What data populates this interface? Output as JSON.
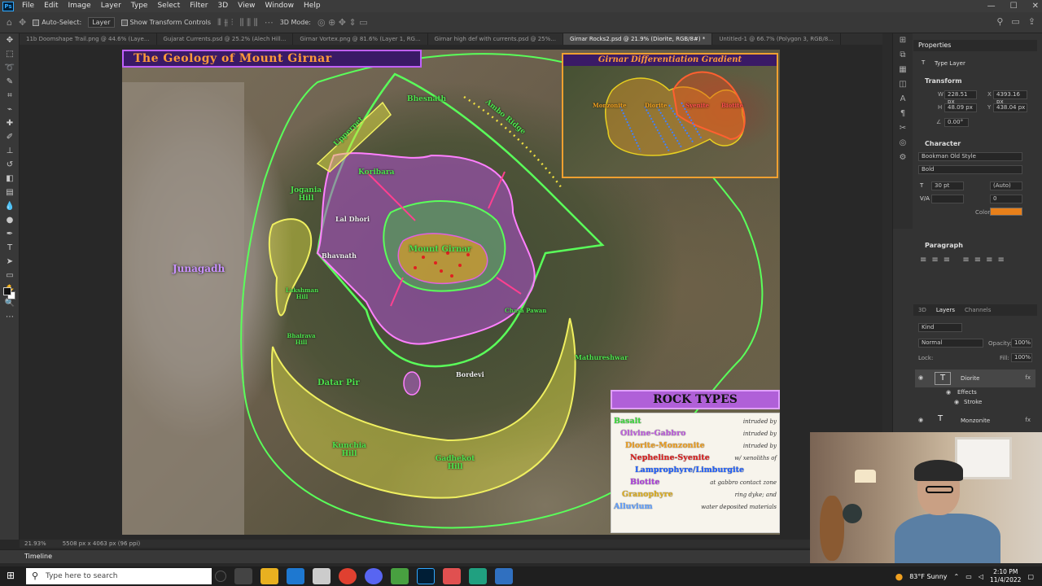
{
  "menubar": {
    "items": [
      "File",
      "Edit",
      "Image",
      "Layer",
      "Type",
      "Select",
      "Filter",
      "3D",
      "View",
      "Window",
      "Help"
    ]
  },
  "options_bar": {
    "auto_select_label": "Auto-Select:",
    "auto_select_value": "Layer",
    "transform_controls_label": "Show Transform Controls",
    "mode_label": "3D Mode:"
  },
  "tabs": [
    {
      "label": "11b Doomshape Trail.png @ 44.6% (Laye...",
      "active": false
    },
    {
      "label": "Gujarat Currents.psd @ 25.2% (Alech Hill...",
      "active": false
    },
    {
      "label": "Girnar Vortex.png @ 81.6% (Layer 1, RG...",
      "active": false
    },
    {
      "label": "Girnar high def with currents.psd @ 25%...",
      "active": false
    },
    {
      "label": "Girnar Rocks2.psd @ 21.9% (Diorite, RGB/8#) *",
      "active": true
    },
    {
      "label": "Untitled-1 @ 66.7% (Polygon 3, RGB/8...",
      "active": false
    }
  ],
  "map": {
    "title": "The Geology of Mount Girnar",
    "labels": {
      "bhesnath": "Bhesnath",
      "ambo_ridge": "Ambo Ridge",
      "datar_top": "Datar Pir",
      "koribara": "Koribara",
      "jogania_hill": "Jogania Hill",
      "lal_dhori": "Lal Dhori",
      "bhavnath": "Bhavnath",
      "mount_girnar": "Mount Girnar",
      "junagadh": "Junagadh",
      "lakshman_hill": "Lakshman Hill",
      "bhairava_hill": "Bhairava Hill",
      "datar_pir": "Datar Pir",
      "bordevi": "Bordevi",
      "chasa_pawan": "Chasa Pawan",
      "mathureshwar": "Mathureshwar",
      "kunchia_hill": "Kunchia Hill",
      "gadhekot_hill": "Gadhekot Hill",
      "upperpet": "Upperpet"
    }
  },
  "inset": {
    "title": "Girnar Differentiation Gradient",
    "labels": {
      "monzonite": "Monzonite",
      "diorite": "Diorite",
      "syenite": "Syenite",
      "biotite": "Biotite"
    }
  },
  "legend": {
    "title": "ROCK TYPES",
    "rows": [
      {
        "name": "Basalt",
        "note": "intruded by",
        "color": "#3ddc3d"
      },
      {
        "name": "Olivine-Gabbro",
        "note": "intruded by",
        "color": "#c060e0"
      },
      {
        "name": "Diorite-Monzonite",
        "note": "intruded by",
        "color": "#f0a020"
      },
      {
        "name": "Nepheline-Syenite",
        "note": "w/ xenoliths of",
        "color": "#e02020"
      },
      {
        "name": "Lamprophyre/Limburgite",
        "note": "",
        "color": "#2060ff"
      },
      {
        "name": "Biotite",
        "note": "at gabbro contact zone",
        "color": "#b040e0"
      },
      {
        "name": "Granophyre",
        "note": "ring dyke; and",
        "color": "#e0b020"
      },
      {
        "name": "Alluvium",
        "note": "water deposited materials",
        "color": "#60a0ff"
      }
    ]
  },
  "properties": {
    "panel_title": "Properties",
    "type_layer": "Type Layer",
    "transform_head": "Transform",
    "w": "228.51 px",
    "x": "4393.16 px",
    "h": "48.09 px",
    "y": "438.04 px",
    "angle": "0.00°",
    "character_head": "Character",
    "font": "Bookman Old Style",
    "style": "Bold",
    "size": "30 pt",
    "leading": "(Auto)",
    "tracking": "0",
    "color_label": "Color",
    "color_value": "#e8801a",
    "paragraph_head": "Paragraph"
  },
  "layers_panel": {
    "tabs": [
      "3D",
      "Layers",
      "Channels"
    ],
    "kind": "Kind",
    "blend": "Normal",
    "opacity_label": "Opacity:",
    "opacity": "100%",
    "lock_label": "Lock:",
    "fill_label": "Fill:",
    "fill": "100%",
    "layers": [
      {
        "name": "Diorite",
        "selected": true
      },
      {
        "name": "Effects",
        "selected": false
      },
      {
        "name": "Stroke",
        "selected": false
      },
      {
        "name": "Monzonite",
        "selected": false
      }
    ]
  },
  "status": {
    "zoom": "21.93%",
    "doc_size": "5508 px x 4063 px (96 ppi)"
  },
  "timeline": {
    "label": "Timeline"
  },
  "taskbar": {
    "search_placeholder": "Type here to search",
    "weather": "83°F  Sunny",
    "time": "2:10 PM",
    "date": "11/4/2022"
  }
}
